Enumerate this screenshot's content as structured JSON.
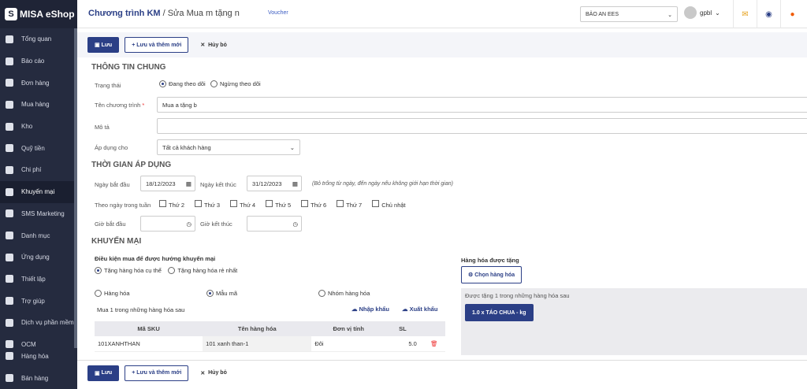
{
  "brand": {
    "name": "MISA eShop"
  },
  "sidebar": {
    "items": [
      {
        "label": "Tổng quan",
        "icon": "dashboard-icon"
      },
      {
        "label": "Báo cáo",
        "icon": "report-icon"
      },
      {
        "label": "Đơn hàng",
        "icon": "order-icon"
      },
      {
        "label": "Mua hàng",
        "icon": "cart-icon"
      },
      {
        "label": "Kho",
        "icon": "warehouse-icon"
      },
      {
        "label": "Quỹ tiền",
        "icon": "cash-icon"
      },
      {
        "label": "Chi phí",
        "icon": "expense-icon"
      },
      {
        "label": "Khuyến mại",
        "icon": "gift-icon"
      },
      {
        "label": "SMS Marketing",
        "icon": "sms-icon"
      },
      {
        "label": "Danh mục",
        "icon": "list-icon"
      },
      {
        "label": "Ứng dụng",
        "icon": "apps-icon"
      },
      {
        "label": "Thiết lập",
        "icon": "gear-icon"
      },
      {
        "label": "Trợ giúp",
        "icon": "help-icon"
      },
      {
        "label": "Dịch vụ phần mềm",
        "icon": "service-icon"
      },
      {
        "label": "OCM",
        "icon": "ocm-icon"
      }
    ],
    "bottom": [
      {
        "label": "Hàng hóa",
        "icon": "goods-icon"
      },
      {
        "label": "Bán hàng",
        "icon": "sell-icon"
      }
    ]
  },
  "topbar": {
    "crumb_main": "Chương trình KM",
    "crumb_sep": " / ",
    "crumb_sub": "Sửa Mua m tặng n",
    "voucher": "Voucher",
    "store": "BẢO AN EES",
    "user": "gpbl"
  },
  "toolbar": {
    "save": "Lưu",
    "save_new": "Lưu và thêm mới",
    "cancel": "Hủy bỏ"
  },
  "general": {
    "title": "THÔNG TIN CHUNG",
    "status_label": "Trạng thái",
    "status_on": "Đang theo dõi",
    "status_off": "Ngừng theo dõi",
    "name_label": "Tên chương trình",
    "name_value": "Mua a tặng b",
    "desc_label": "Mô tả",
    "apply_label": "Áp dụng cho",
    "apply_value": "Tất cả khách hàng"
  },
  "time": {
    "title": "THỜI GIAN ÁP DỤNG",
    "start_label": "Ngày bắt đầu",
    "start": "18/12/2023",
    "end_label": "Ngày kết thúc",
    "end": "31/12/2023",
    "hint": "(Bỏ trống từ ngày, đến ngày nếu không giới hạn thời gian)",
    "weekday_label": "Theo ngày trong tuần",
    "days": [
      "Thứ 2",
      "Thứ 3",
      "Thứ 4",
      "Thứ 5",
      "Thứ 6",
      "Thứ 7",
      "Chủ nhật"
    ],
    "hour_start_label": "Giờ bắt đầu",
    "hour_end_label": "Giờ kết thúc"
  },
  "promo": {
    "title": "KHUYẾN MẠI",
    "cond_label": "Điều kiện mua để được hưởng khuyến mại",
    "opt1": "Tặng hàng hóa cụ thể",
    "opt2": "Tặng hàng hóa rẻ nhất",
    "type1": "Hàng hóa",
    "type2": "Mẫu mã",
    "type3": "Nhóm hàng hóa",
    "buy_note": "Mua 1 trong những hàng hóa sau",
    "import": "Nhập khẩu",
    "export": "Xuất khẩu",
    "columns": [
      "Mã SKU",
      "Tên hàng hóa",
      "Đơn vị tính",
      "SL"
    ],
    "rows": [
      {
        "sku": "101XANHTHAN",
        "name": "101 xanh than-1",
        "unit": "Đôi",
        "qty": "5.0"
      }
    ],
    "gift_title": "Hàng hóa được tặng",
    "choose_btn": "Chọn hàng hóa",
    "gift_note": "Được tặng 1 trong những hàng hóa sau",
    "gift_item": "1.0 x TÁO CHUA - kg"
  }
}
